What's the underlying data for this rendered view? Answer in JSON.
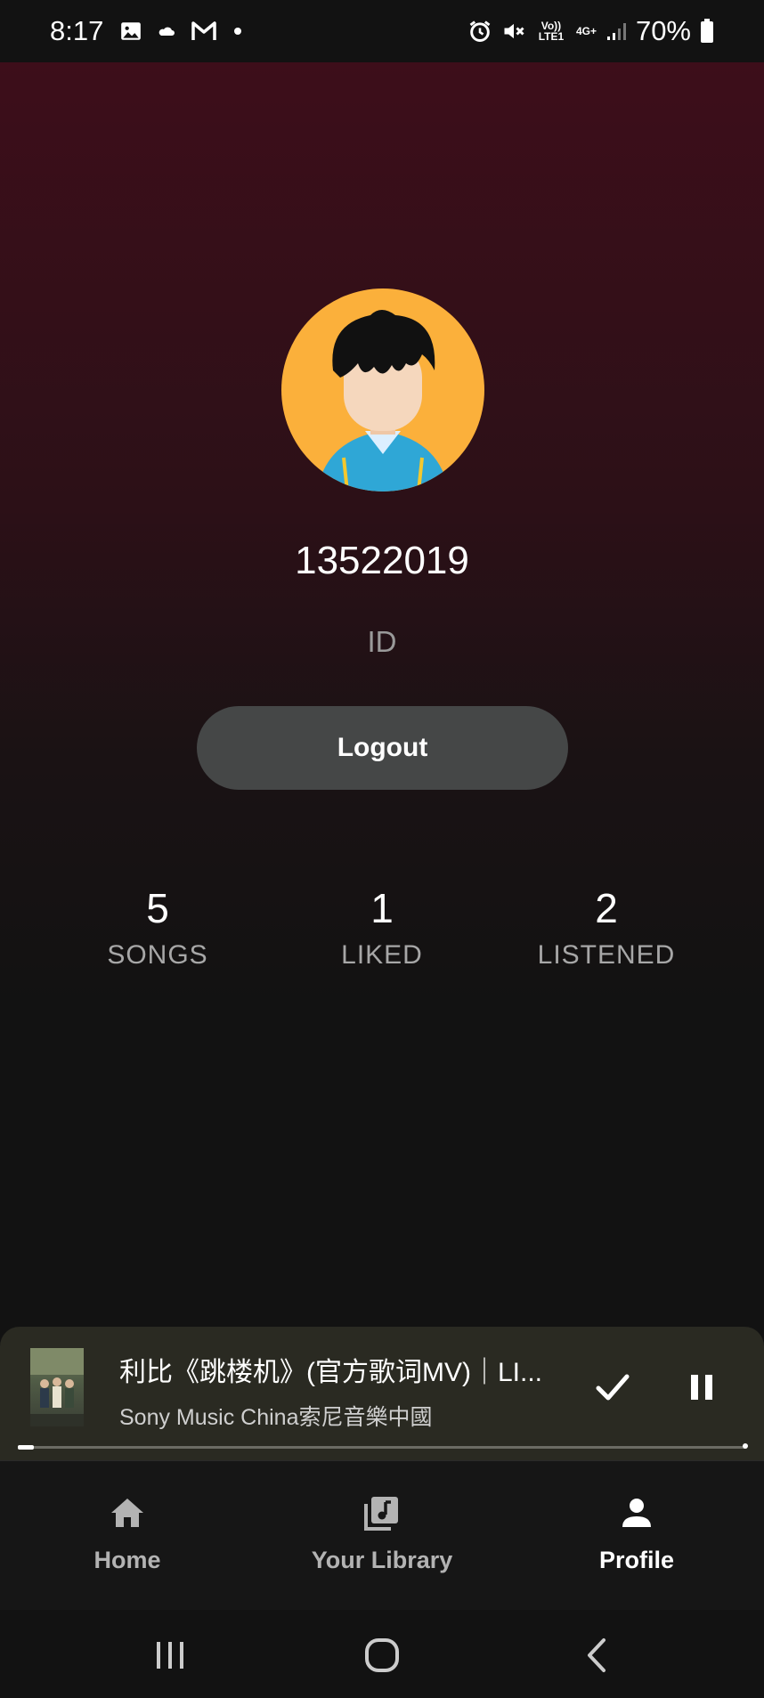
{
  "status_bar": {
    "time": "8:17",
    "battery": "70%",
    "net_line1": "Vo)) LTE1",
    "net_line2": "4G+",
    "icons": [
      "gallery-icon",
      "cloud-icon",
      "gmail-icon",
      "dot-icon",
      "alarm-icon",
      "mute-icon",
      "signal-icon",
      "battery-icon"
    ]
  },
  "profile": {
    "username": "13522019",
    "id_label": "ID",
    "logout_label": "Logout"
  },
  "stats": [
    {
      "value": "5",
      "label": "SONGS"
    },
    {
      "value": "1",
      "label": "LIKED"
    },
    {
      "value": "2",
      "label": "LISTENED"
    }
  ],
  "player": {
    "title": "利比《跳楼机》(官方歌词MV)｜LI...",
    "artist": "Sony Music China索尼音樂中國",
    "progress": 0.02
  },
  "nav": {
    "items": [
      {
        "label": "Home",
        "icon": "home-icon"
      },
      {
        "label": "Your Library",
        "icon": "library-icon"
      },
      {
        "label": "Profile",
        "icon": "person-icon"
      }
    ],
    "active": "Profile"
  },
  "colors": {
    "accent_gradient_top": "#3d0e1a",
    "background": "#121212",
    "avatar_bg": "#fbb03b",
    "logout_bg": "#454747",
    "player_bg": "#2a2a22"
  }
}
